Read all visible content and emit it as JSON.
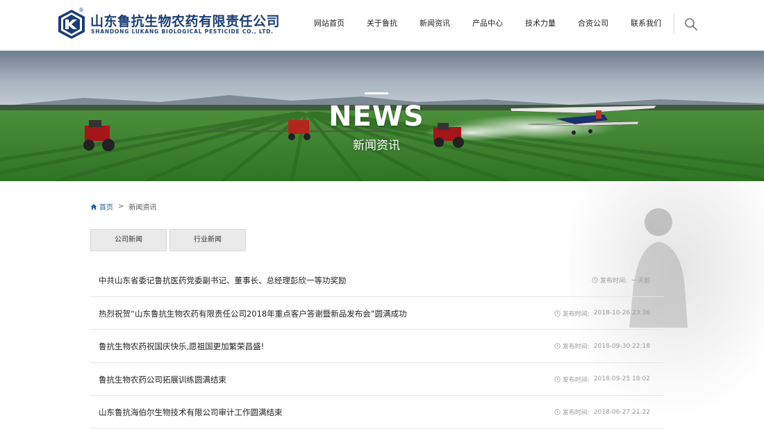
{
  "brand": {
    "name_cn": "山东鲁抗生物农药有限责任公司",
    "name_en": "SHANDONG LUKANG BIOLOGICAL PESTICIDE CO., LTD.",
    "registered_mark": "®"
  },
  "nav": {
    "items": [
      {
        "label": "网站首页"
      },
      {
        "label": "关于鲁抗"
      },
      {
        "label": "新闻资讯"
      },
      {
        "label": "产品中心"
      },
      {
        "label": "技术力量"
      },
      {
        "label": "合资公司"
      },
      {
        "label": "联系我们"
      }
    ],
    "search_icon": "search-icon"
  },
  "banner": {
    "title": "NEWS",
    "subtitle": "新闻资讯"
  },
  "breadcrumb": {
    "home": "首页",
    "separator": ">",
    "current": "新闻资讯"
  },
  "tabs": [
    {
      "label": "公司新闻"
    },
    {
      "label": "行业新闻"
    }
  ],
  "news": {
    "meta_label": "发布时间:",
    "items": [
      {
        "title": "中共山东省委记鲁抗医药党委副书记、董事长、总经理彭欣一等功奖励",
        "date": "一天前"
      },
      {
        "title": "热烈祝贺“山东鲁抗生物农药有限责任公司2018年重点客户答谢暨新品发布会”圆满成功",
        "date": "2018-10-26 23:36"
      },
      {
        "title": "鲁抗生物农药祝国庆快乐,愿祖国更加繁荣昌盛!",
        "date": "2018-09-30 22:18"
      },
      {
        "title": "鲁抗生物农药公司拓展训练圆满结束",
        "date": "2018-09-25 18:02"
      },
      {
        "title": "山东鲁抗海伯尔生物技术有限公司审计工作圆满结束",
        "date": "2018-06-27 21:22"
      }
    ]
  },
  "colors": {
    "brand_blue": "#1b3f74",
    "link_blue": "#1f5fa8",
    "field_green": "#3f8a2e"
  }
}
